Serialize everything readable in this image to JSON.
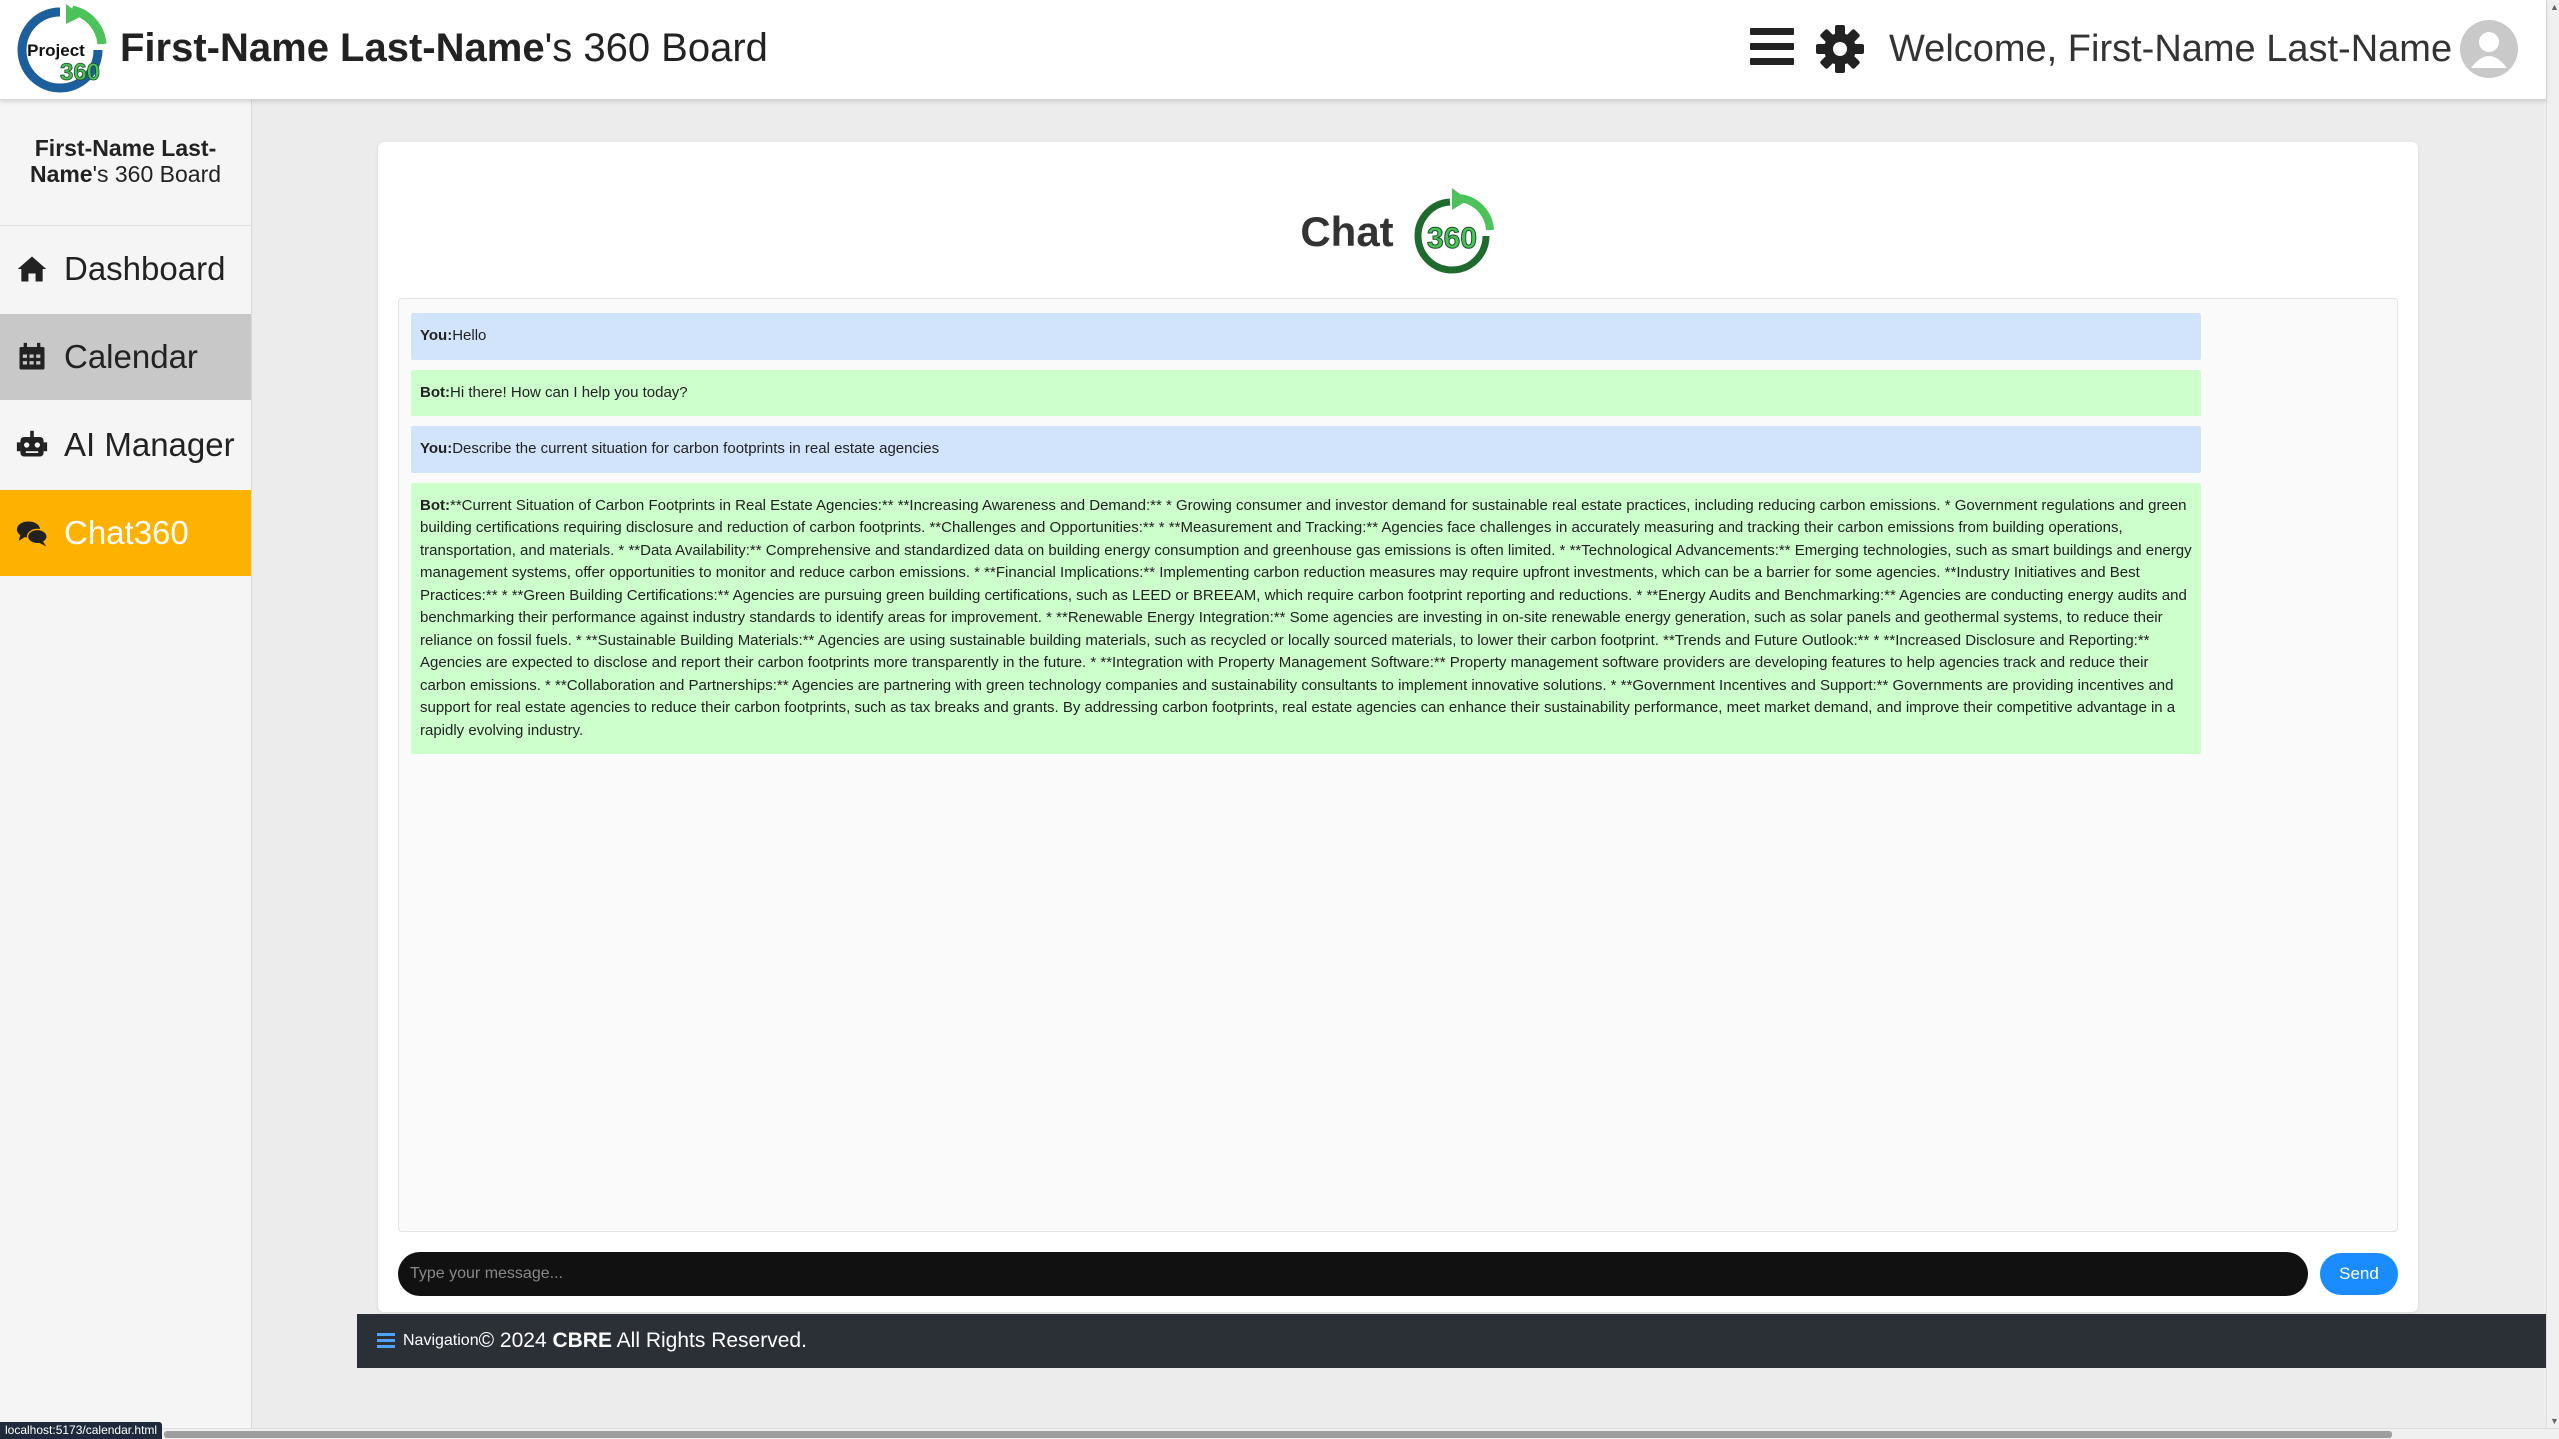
{
  "header": {
    "logo_text": "Project 360",
    "title_bold": "First-Name Last-Name",
    "title_rest": "'s 360 Board",
    "welcome": "Welcome, First-Name Last-Name",
    "icons": {
      "menu": "hamburger-menu-icon",
      "settings": "gear-icon",
      "avatar": "user-avatar-icon"
    }
  },
  "sidebar": {
    "title_bold": "First-Name Last-Name",
    "title_rest": "'s 360 Board",
    "items": [
      {
        "label": "Dashboard",
        "icon": "home-icon",
        "state": "normal"
      },
      {
        "label": "Calendar",
        "icon": "calendar-icon",
        "state": "hover"
      },
      {
        "label": "AI Manager",
        "icon": "robot-icon",
        "state": "normal"
      },
      {
        "label": "Chat360",
        "icon": "chat-bubbles-icon",
        "state": "active"
      }
    ]
  },
  "chat": {
    "heading": "Chat",
    "logo_text": "360",
    "messages": [
      {
        "sender": "You:",
        "role": "user",
        "text": "Hello"
      },
      {
        "sender": "Bot:",
        "role": "bot",
        "text": "Hi there! How can I help you today?"
      },
      {
        "sender": "You:",
        "role": "user",
        "text": "Describe the current situation for carbon footprints in real estate agencies"
      },
      {
        "sender": "Bot:",
        "role": "bot",
        "text": "**Current Situation of Carbon Footprints in Real Estate Agencies:** **Increasing Awareness and Demand:** * Growing consumer and investor demand for sustainable real estate practices, including reducing carbon emissions. * Government regulations and green building certifications requiring disclosure and reduction of carbon footprints. **Challenges and Opportunities:** * **Measurement and Tracking:** Agencies face challenges in accurately measuring and tracking their carbon emissions from building operations, transportation, and materials. * **Data Availability:** Comprehensive and standardized data on building energy consumption and greenhouse gas emissions is often limited. * **Technological Advancements:** Emerging technologies, such as smart buildings and energy management systems, offer opportunities to monitor and reduce carbon emissions. * **Financial Implications:** Implementing carbon reduction measures may require upfront investments, which can be a barrier for some agencies. **Industry Initiatives and Best Practices:** * **Green Building Certifications:** Agencies are pursuing green building certifications, such as LEED or BREEAM, which require carbon footprint reporting and reductions. * **Energy Audits and Benchmarking:** Agencies are conducting energy audits and benchmarking their performance against industry standards to identify areas for improvement. * **Renewable Energy Integration:** Some agencies are investing in on-site renewable energy generation, such as solar panels and geothermal systems, to reduce their reliance on fossil fuels. * **Sustainable Building Materials:** Agencies are using sustainable building materials, such as recycled or locally sourced materials, to lower their carbon footprint. **Trends and Future Outlook:** * **Increased Disclosure and Reporting:** Agencies are expected to disclose and report their carbon footprints more transparently in the future. * **Integration with Property Management Software:** Property management software providers are developing features to help agencies track and reduce their carbon emissions. * **Collaboration and Partnerships:** Agencies are partnering with green technology companies and sustainability consultants to implement innovative solutions. * **Government Incentives and Support:** Governments are providing incentives and support for real estate agencies to reduce their carbon footprints, such as tax breaks and grants. By addressing carbon footprints, real estate agencies can enhance their sustainability performance, meet market demand, and improve their competitive advantage in a rapidly evolving industry."
      }
    ],
    "input_placeholder": "Type your message...",
    "send_label": "Send"
  },
  "footer": {
    "nav_label": "Navigation",
    "copyright_prefix": "© 2024 ",
    "company": "CBRE",
    "copyright_suffix": " All Rights Reserved."
  },
  "status_bar": {
    "url": "localhost:5173/calendar.html"
  },
  "colors": {
    "active_nav": "#ffb100",
    "hover_nav": "#c8c8c8",
    "user_bubble": "#d2e4fb",
    "bot_bubble": "#ccffcc",
    "send_button": "#1a8cff",
    "footer_bg": "#2b2f36",
    "logo_green": "#4cc35a"
  }
}
